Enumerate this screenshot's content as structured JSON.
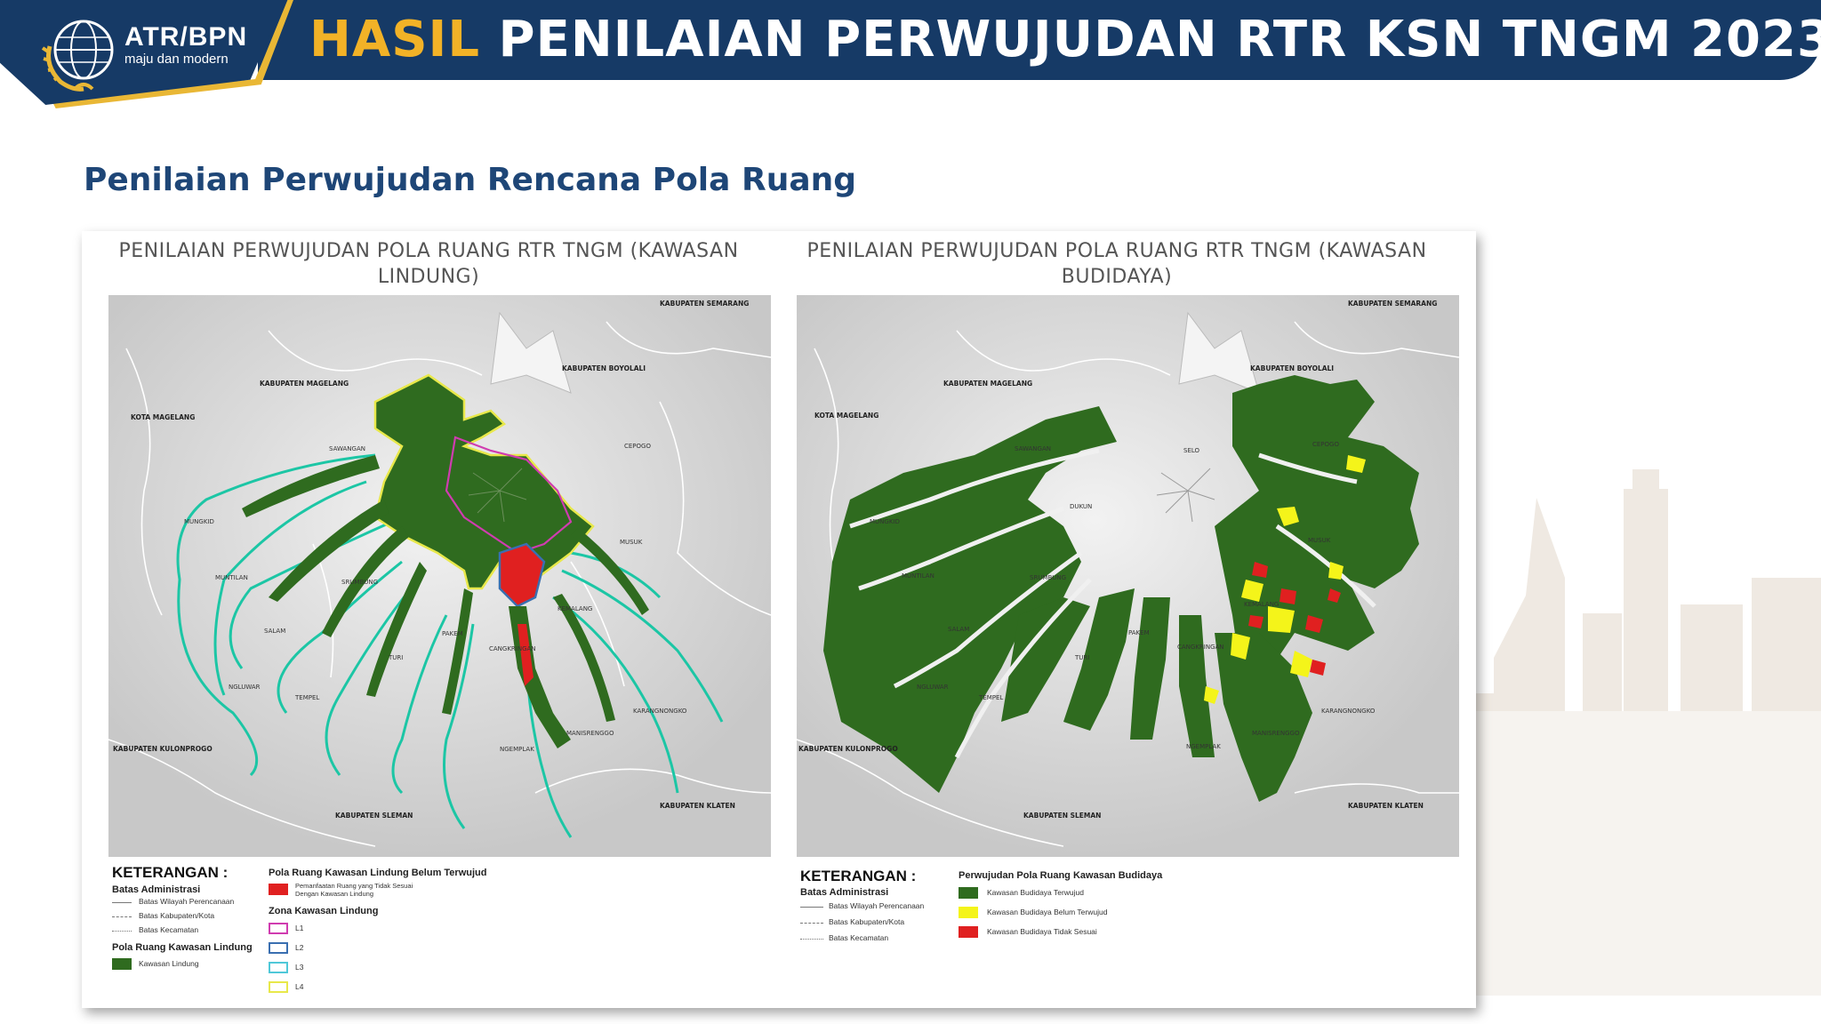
{
  "header": {
    "logo": {
      "name": "ATR/BPN",
      "tagline": "maju dan modern"
    },
    "title_accent": "HASIL",
    "title_rest": " PENILAIAN PERWUJUDAN RTR KSN TNGM 2023"
  },
  "section_title": "Penilaian Perwujudan Rencana Pola Ruang",
  "colors": {
    "navy": "#163a66",
    "gold": "#f2b227",
    "forest_green": "#2f6b1f",
    "violation_red": "#e02020",
    "unrealized_yellow": "#f4f41a",
    "river_teal": "#1cc6a5"
  },
  "maps": {
    "left": {
      "title": "PENILAIAN PERWUJUDAN POLA RUANG RTR TNGM (KAWASAN LINDUNG)",
      "labels": {
        "semarang": "KABUPATEN SEMARANG",
        "boyolali": "KABUPATEN BOYOLALI",
        "magelang": "KABUPATEN MAGELANG",
        "kota_magelang": "KOTA MAGELANG",
        "sawangan": "SAWANGAN",
        "cepogo": "CEPOGO",
        "mungkid": "MUNGKID",
        "musuk": "MUSUK",
        "muntilan": "MUNTILAN",
        "srumbung": "SRUMBUNG",
        "kemalang": "KEMALANG",
        "salam": "SALAM",
        "pakem": "PAKEM",
        "cangkringan": "CANGKRINGAN",
        "turi": "TURI",
        "ngluwar": "NGLUWAR",
        "tempel": "TEMPEL",
        "karangnongko": "KARANGNONGKO",
        "manisrenggo": "MANISRENGGO",
        "ngemplak": "NGEMPLAK",
        "kulonprogo": "KABUPATEN KULONPROGO",
        "klaten": "KABUPATEN KLATEN",
        "sleman": "KABUPATEN SLEMAN",
        "dukun": "DUKUN"
      },
      "legend": {
        "heading": "KETERANGAN :",
        "admin_heading": "Batas Administrasi",
        "admin_items": [
          "Batas Wilayah Perencanaan",
          "Batas Kabupaten/Kota",
          "Batas Kecamatan"
        ],
        "lindung_heading": "Pola Ruang Kawasan Lindung",
        "lindung_item": "Kawasan Lindung",
        "unrealized_heading": "Pola Ruang Kawasan Lindung Belum Terwujud",
        "unrealized_item_1": "Pemanfaatan Ruang yang Tidak Sesuai",
        "unrealized_item_2": "Dengan Kawasan Lindung",
        "zona_heading": "Zona Kawasan Lindung",
        "zones": [
          {
            "label": "L1",
            "color": "#d03cb0"
          },
          {
            "label": "L2",
            "color": "#3a6fb0"
          },
          {
            "label": "L3",
            "color": "#4fc8d8"
          },
          {
            "label": "L4",
            "color": "#e8e84a"
          }
        ]
      }
    },
    "right": {
      "title": "PENILAIAN PERWUJUDAN POLA RUANG RTR TNGM (KAWASAN BUDIDAYA)",
      "labels": {
        "semarang": "KABUPATEN SEMARANG",
        "boyolali": "KABUPATEN BOYOLALI",
        "magelang": "KABUPATEN MAGELANG",
        "kota_magelang": "KOTA MAGELANG",
        "sawangan": "SAWANGAN",
        "selo": "SELO",
        "cepogo": "CEPOGO",
        "dukun": "DUKUN",
        "mungkid": "MUNGKID",
        "musuk": "MUSUK",
        "muntilan": "MUNTILAN",
        "srumbung": "SRUMBUNG",
        "kemalang": "KEMALANG",
        "salam": "SALAM",
        "pakem": "PAKEM",
        "cangkringan": "CANGKRINGAN",
        "turi": "TURI",
        "tempel": "TEMPEL",
        "ngluwar": "NGLUWAR",
        "karangnongko": "KARANGNONGKO",
        "manisrenggo": "MANISRENGGO",
        "ngemplak": "NGEMPLAK",
        "kulonprogo": "KABUPATEN KULONPROGO",
        "klaten": "KABUPATEN KLATEN",
        "sleman": "KABUPATEN SLEMAN"
      },
      "legend": {
        "heading": "KETERANGAN :",
        "admin_heading": "Batas Administrasi",
        "admin_items": [
          "Batas Wilayah Perencanaan",
          "Batas Kabupaten/Kota",
          "Batas Kecamatan"
        ],
        "budidaya_heading": "Perwujudan Pola Ruang Kawasan Budidaya",
        "items": [
          {
            "label": "Kawasan Budidaya Terwujud",
            "color": "#2f6b1f"
          },
          {
            "label": "Kawasan Budidaya Belum Terwujud",
            "color": "#f4f41a"
          },
          {
            "label": "Kawasan Budidaya Tidak Sesuai",
            "color": "#e02020"
          }
        ]
      }
    }
  }
}
